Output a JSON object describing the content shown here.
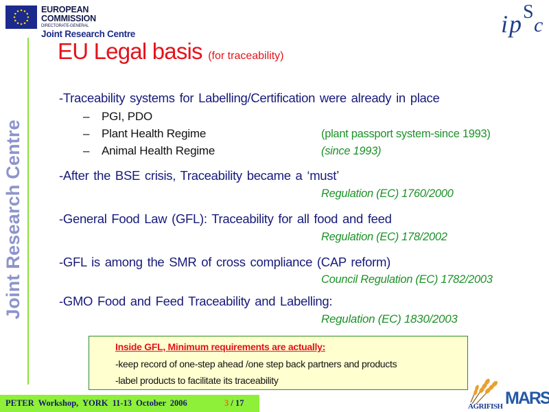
{
  "header": {
    "org_name": "EUROPEAN COMMISSION",
    "directorate": "DIRECTORATE-GENERAL",
    "centre": "Joint Research Centre",
    "institute_logo": {
      "letters": [
        "i",
        "p",
        "S",
        "c"
      ]
    }
  },
  "sidebar": {
    "title": "Joint Research Centre",
    "accent_color": "#8ee03c"
  },
  "slide": {
    "title": "EU Legal basis",
    "subtitle": "(for traceability)",
    "sections": [
      {
        "text": "-Traceability systems for Labelling/Certification were already in place",
        "sub_items": [
          {
            "dash": "–",
            "label": "PGI, PDO",
            "note": ""
          },
          {
            "dash": "–",
            "label": "Plant Health Regime",
            "note": "(plant passport system-since 1993)"
          },
          {
            "dash": "–",
            "label": "Animal Health Regime",
            "note": "(since 1993)"
          }
        ]
      },
      {
        "text": "-After the BSE crisis, Traceability became a ‘must’",
        "reference": "Regulation (EC) 1760/2000"
      },
      {
        "text": "-General Food Law (GFL): Traceability for all food and feed",
        "reference": "Regulation (EC) 178/2002"
      },
      {
        "text": "-GFL is among the SMR of cross compliance (CAP reform)",
        "reference": "Council Regulation (EC) 1782/2003"
      },
      {
        "text": "-GMO Food and Feed Traceability and Labelling:",
        "reference": "Regulation (EC) 1830/2003"
      }
    ],
    "box": {
      "heading": "Inside GFL, Minimum requirements are actually:",
      "items": [
        "-keep record of one-step ahead /one step back partners and products",
        "-label products to facilitate its traceability"
      ]
    }
  },
  "footer": {
    "event": "PETER Workshop, YORK 11-13 October 2006",
    "page_current": "3",
    "page_separator": " / ",
    "page_total": "17",
    "logos": {
      "agrifish": "AGRIFISH",
      "mars": "MARS"
    }
  },
  "colors": {
    "title_red": "#e3131b",
    "body_blue": "#171a7a",
    "reference_green": "#1e9128",
    "box_bg": "#ffffd0",
    "footer_green": "#8ef038"
  }
}
